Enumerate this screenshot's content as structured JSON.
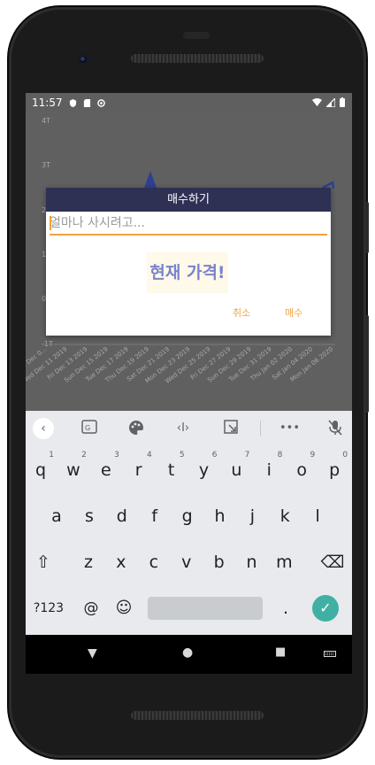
{
  "status_bar": {
    "time": "11:57"
  },
  "chart_data": {
    "type": "line",
    "y_ticks": [
      "4T",
      "3T",
      "2T",
      "1T",
      "0",
      "-1T"
    ],
    "x_labels": [
      "Mon Dec 0...",
      "Wed Dec 11 2019",
      "Fri Dec 13 2019",
      "Sun Dec 15 2019",
      "Tue Dec 17 2019",
      "Thu Dec 19 2019",
      "Sat Dec 21 2019",
      "Mon Dec 23 2019",
      "Wed Dec 25 2019",
      "Fri Dec 27 2019",
      "Sun Dec 29 2019",
      "Tue Dec 31 2019",
      "Thu Jan 02 2020",
      "Sat Jan 04 2020",
      "Mon Jan 06 2020"
    ],
    "colors": {
      "line": "#2f3f8f",
      "axis_text": "#a9a9a9"
    }
  },
  "dialog": {
    "title": "매수하기",
    "input_placeholder": "얼마나 사시려고...",
    "price_label": "현재 가격!",
    "cancel_label": "취소",
    "buy_label": "매수"
  },
  "keyboard": {
    "toolbar_icons": [
      "chevron-left-icon",
      "sticker-icon",
      "palette-icon",
      "cursor-move-icon",
      "resize-icon",
      "more-icon",
      "mic-off-icon"
    ],
    "rows": [
      [
        {
          "k": "q",
          "h": "1"
        },
        {
          "k": "w",
          "h": "2"
        },
        {
          "k": "e",
          "h": "3"
        },
        {
          "k": "r",
          "h": "4"
        },
        {
          "k": "t",
          "h": "5"
        },
        {
          "k": "y",
          "h": "6"
        },
        {
          "k": "u",
          "h": "7"
        },
        {
          "k": "i",
          "h": "8"
        },
        {
          "k": "o",
          "h": "9"
        },
        {
          "k": "p",
          "h": "0"
        }
      ],
      [
        {
          "k": "a"
        },
        {
          "k": "s"
        },
        {
          "k": "d"
        },
        {
          "k": "f"
        },
        {
          "k": "g"
        },
        {
          "k": "h"
        },
        {
          "k": "j"
        },
        {
          "k": "k"
        },
        {
          "k": "l"
        }
      ],
      [
        {
          "k": "z"
        },
        {
          "k": "x"
        },
        {
          "k": "c"
        },
        {
          "k": "v"
        },
        {
          "k": "b"
        },
        {
          "k": "n"
        },
        {
          "k": "m"
        }
      ]
    ],
    "shift_label": "⇧",
    "backspace_label": "⌫",
    "symbols_label": "?123",
    "at_label": "@",
    "emoji_label": "☺",
    "period_label": ".",
    "enter_label": "✓"
  },
  "nav_bar": {
    "back_icon": "▼",
    "home_icon": "●",
    "recents_icon": "■"
  }
}
